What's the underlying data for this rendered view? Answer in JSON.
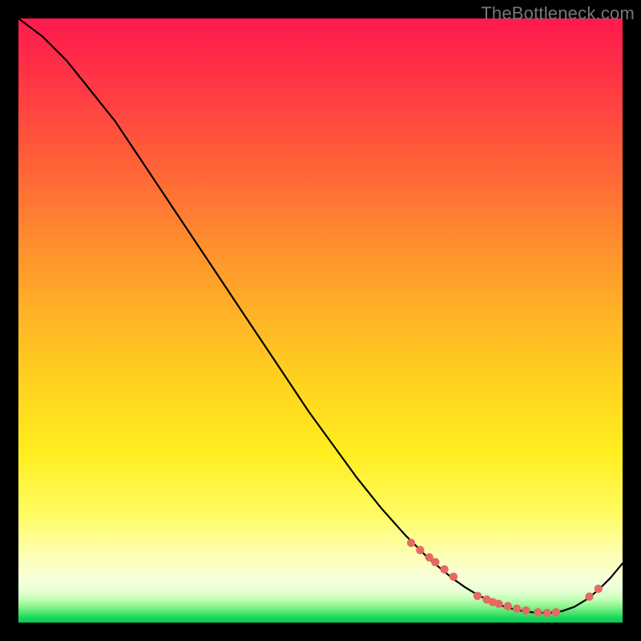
{
  "watermark": "TheBottleneck.com",
  "chart_data": {
    "type": "line",
    "title": "",
    "xlabel": "",
    "ylabel": "",
    "xlim": [
      0,
      100
    ],
    "ylim": [
      0,
      100
    ],
    "series": [
      {
        "name": "curve",
        "x": [
          0,
          4,
          8,
          12,
          16,
          20,
          24,
          28,
          32,
          36,
          40,
          44,
          48,
          52,
          56,
          60,
          64,
          68,
          72,
          74,
          76,
          78,
          80,
          82,
          84,
          86,
          88,
          90,
          92,
          94,
          96,
          98,
          100
        ],
        "y": [
          100,
          97,
          93,
          88,
          83,
          77,
          71,
          65,
          59,
          53,
          47,
          41,
          35,
          29.5,
          24,
          19,
          14.5,
          10.5,
          7.2,
          5.8,
          4.6,
          3.6,
          2.8,
          2.2,
          1.8,
          1.6,
          1.6,
          1.9,
          2.6,
          3.8,
          5.4,
          7.4,
          9.8
        ]
      }
    ],
    "markers": {
      "name": "highlight-points",
      "color": "#e46a63",
      "x": [
        65,
        66.5,
        68,
        69,
        70.5,
        72,
        76,
        77.5,
        78.5,
        79.5,
        81,
        82.5,
        84,
        86,
        87.5,
        89,
        94.5,
        96
      ],
      "y": [
        13.2,
        12.0,
        10.8,
        10.0,
        8.8,
        7.6,
        4.4,
        3.8,
        3.4,
        3.1,
        2.7,
        2.3,
        2.0,
        1.7,
        1.6,
        1.7,
        4.3,
        5.6
      ]
    },
    "background_gradient": {
      "orientation": "vertical",
      "stops": [
        {
          "pos": 0.0,
          "color": "#ff1a4f"
        },
        {
          "pos": 0.36,
          "color": "#ff8a2f"
        },
        {
          "pos": 0.72,
          "color": "#ffee1f"
        },
        {
          "pos": 0.93,
          "color": "#f5ffd8"
        },
        {
          "pos": 1.0,
          "color": "#0acb55"
        }
      ]
    }
  }
}
